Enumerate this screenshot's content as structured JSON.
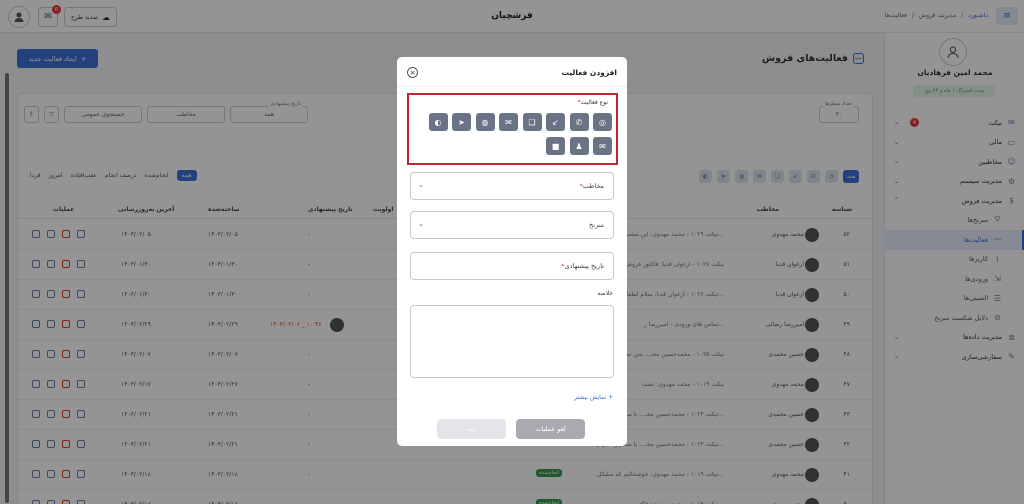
{
  "header": {
    "brand": "فرشچیان",
    "renew_label": "تمدید طرح",
    "notif_count": "6",
    "breadcrumb": [
      "داشبورد",
      "مدیریت فروش",
      "فعالیت‌ها"
    ]
  },
  "sidebar": {
    "profile_name": "محمد امین فرهادیان",
    "profile_sub": "مدت اشتراک ۱ ماه و ۲۴ روز",
    "items": [
      {
        "label": "تیکت",
        "badge": "4",
        "chev": "⌄",
        "sub": false
      },
      {
        "label": "مالی",
        "chev": "⌄",
        "sub": false
      },
      {
        "label": "مخاطبین",
        "chev": "⌄",
        "sub": false
      },
      {
        "label": "مدیریت سیستم",
        "chev": "⌄",
        "sub": false
      },
      {
        "label": "مدیریت فروش",
        "chev": "⌃",
        "sub": false
      },
      {
        "label": "سرنخ‌ها",
        "sub": true
      },
      {
        "label": "فعالیت‌ها",
        "sub": true,
        "active": true
      },
      {
        "label": "کاریزها",
        "sub": true
      },
      {
        "label": "ورودی‌ها",
        "sub": true
      },
      {
        "label": "الصیتی‌ها",
        "sub": true
      },
      {
        "label": "دلایل شکست سرنخ",
        "sub": true
      },
      {
        "label": "مدیریت داده‌ها",
        "chev": "⌄",
        "sub": false
      },
      {
        "label": "سفارشی‌سازی",
        "chev": "⌄",
        "sub": false
      }
    ]
  },
  "page": {
    "title": "فعالیت‌های فروش",
    "new_button": "ایجاد فعالیت جدید",
    "filters": {
      "rows_label": "تعداد سطرها",
      "rows_value": "۳۰",
      "date_label": "تاریخ پیشنهادی",
      "date_value": "همه",
      "contact_ph": "مخاطب",
      "search_ph": "جستجوی عمومی"
    },
    "status_tabs": [
      "همه",
      "انجام‌شده",
      "درصف انجام",
      "عقب‌افتاده",
      "امروز",
      "فردا"
    ],
    "chip_first": "همه",
    "columns": {
      "id": "شناسه",
      "contact": "مخاطب",
      "priority": "اولویت",
      "suggested_date": "تاریخ پیشنهادی",
      "created": "ساخته‌شده",
      "updated": "آخرین به‌روزرسانی",
      "actions": "عملیات"
    },
    "rows": [
      {
        "id": "۵۲",
        "contact": "محمد مهدوی",
        "subject": "تیکت ۱۰۲۹ - محمد مهدوی: این مشتری خیلی مع...",
        "suggested": "-",
        "created": "۱۴۰۳/۰۲/۰۵",
        "updated": "۱۴۰۳/۰۲/۰۵",
        "status": ""
      },
      {
        "id": "۵۱",
        "contact": "ارغوان قدیا",
        "subject": "تیکت ۱۰۲۷ - ارغوان قدیا: فاکتور فروش",
        "suggested": "-",
        "created": "۱۴۰۳/۰۱/۳۰",
        "updated": "۱۴۰۳/۰۱/۳۰",
        "status": ""
      },
      {
        "id": "۵۰",
        "contact": "ارغوان قدیا",
        "subject": "تیکت ۱۰۲۶ - ارغوان قدیا: سلام لطفا فاکتور...",
        "suggested": "-",
        "created": "۱۴۰۳/۰۱/۳۰",
        "updated": "۱۴۰۳/۰۱/۳۰",
        "status": ""
      },
      {
        "id": "۴۹",
        "contact": "امیررضا رضائی",
        "subject": "تماس های ورودی - امیررضا ر...",
        "suggested": "۱۴۰۳/۰۲/۰۶ _ ۱۰:۴۶",
        "created": "۱۴۰۳/۰۲/۲۹",
        "updated": "۱۴۰۳/۰۲/۲۹",
        "status": "",
        "hot": true
      },
      {
        "id": "۴۸",
        "contact": "حسین محمدی",
        "subject": "تیکت ۱۰۲۵ - محمدحسین محـ... متن تست",
        "suggested": "-",
        "created": "۱۴۰۳/۰۲/۰۷",
        "updated": "۱۴۰۳/۰۲/۰۷",
        "status": ""
      },
      {
        "id": "۴۷",
        "contact": "محمد مهدوی",
        "subject": "تیکت ۱۰۱۹ - محمد مهدوی: تست",
        "suggested": "-",
        "created": "۱۴۰۳/۰۲/۲۷",
        "updated": "۱۴۰۳/۰۲/۱۷",
        "status": ""
      },
      {
        "id": "۴۳",
        "contact": "حسین محمدی",
        "subject": "تیکت ۱۰۲۴ - محمدحسین محـ... با سلام و احترام...",
        "suggested": "-",
        "created": "۱۴۰۳/۰۲/۲۱",
        "updated": "۱۴۰۳/۰۲/۲۱",
        "status": ""
      },
      {
        "id": "۴۲",
        "contact": "حسین محمدی",
        "subject": "تیکت ۱۰۲۳ - محمدحسین محـ... با سلام و احترام...",
        "suggested": "-",
        "created": "۱۴۰۳/۰۲/۲۱",
        "updated": "۱۴۰۳/۰۲/۲۱",
        "status": ""
      },
      {
        "id": "۴۱",
        "contact": "محمد مهدوی",
        "subject": "تیکت ۱۰۱۹ - محمد مهدوی: خوشحالیم که مشکل...",
        "suggested": "-",
        "created": "۱۴۰۳/۰۲/۱۸",
        "updated": "۱۴۰۳/۰۲/۱۸",
        "status": "انجام‌شده"
      },
      {
        "id": "۴۰",
        "contact": "محمد مهدوی",
        "subject": "تیکت ۱۰۱۹ - محمد مهدوی: فاکتور رسید. ممنو...",
        "suggested": "-",
        "created": "۱۴۰۳/۰۲/۱۸",
        "updated": "۱۴۰۳/۰۲/۱۸",
        "status": "انجام‌شده"
      }
    ]
  },
  "modal": {
    "title": "افزودن فعالیت",
    "type_label": "نوع فعالیت",
    "types_row1": [
      {
        "name": "instagram-icon",
        "glyph": "◎"
      },
      {
        "name": "phone-icon",
        "glyph": "✆"
      },
      {
        "name": "phone-incoming-icon",
        "glyph": "↙"
      },
      {
        "name": "chat-icon",
        "glyph": "❏"
      },
      {
        "name": "email-icon",
        "glyph": "✉"
      },
      {
        "name": "message-icon",
        "glyph": "◍"
      },
      {
        "name": "telegram-icon",
        "glyph": "➤"
      },
      {
        "name": "whatsapp-icon",
        "glyph": "◐"
      }
    ],
    "types_row2": [
      {
        "name": "email-outline-icon",
        "glyph": "✉"
      },
      {
        "name": "meeting-icon",
        "glyph": "♟"
      },
      {
        "name": "video-icon",
        "glyph": "■"
      }
    ],
    "contact_ph": "مخاطب",
    "lead_ph": "سرنخ",
    "date_ph": "تاریخ پیشنهادی",
    "summary_label": "خلاصه",
    "show_more": "نمایش بیشتر",
    "cancel": "لغو عملیات",
    "save": "ثبت"
  }
}
